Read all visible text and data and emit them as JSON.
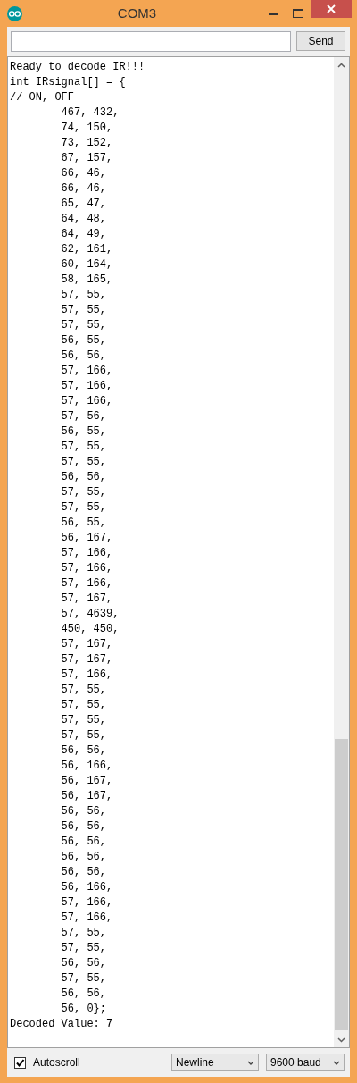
{
  "window": {
    "title": "COM3"
  },
  "send_button": "Send",
  "lines": [
    {
      "text": "Ready to decode IR!!!"
    },
    {
      "text": "int IRsignal[] = {"
    },
    {
      "text": "// ON, OFF"
    },
    {
      "text": "\t467, 432,"
    },
    {
      "text": "\t74, 150,"
    },
    {
      "text": "\t73, 152,"
    },
    {
      "text": "\t67, 157,"
    },
    {
      "text": "\t66, 46,"
    },
    {
      "text": "\t66, 46,"
    },
    {
      "text": "\t65, 47,"
    },
    {
      "text": "\t64, 48,"
    },
    {
      "text": "\t64, 49,"
    },
    {
      "text": "\t62, 161,"
    },
    {
      "text": "\t60, 164,"
    },
    {
      "text": "\t58, 165,"
    },
    {
      "text": "\t57, 55,"
    },
    {
      "text": "\t57, 55,"
    },
    {
      "text": "\t57, 55,"
    },
    {
      "text": "\t56, 55,"
    },
    {
      "text": "\t56, 56,"
    },
    {
      "text": "\t57, 166,"
    },
    {
      "text": "\t57, 166,"
    },
    {
      "text": "\t57, 166,"
    },
    {
      "text": "\t57, 56,"
    },
    {
      "text": "\t56, 55,"
    },
    {
      "text": "\t57, 55,"
    },
    {
      "text": "\t57, 55,"
    },
    {
      "text": "\t56, 56,"
    },
    {
      "text": "\t57, 55,"
    },
    {
      "text": "\t57, 55,"
    },
    {
      "text": "\t56, 55,"
    },
    {
      "text": "\t56, 167,"
    },
    {
      "text": "\t57, 166,"
    },
    {
      "text": "\t57, 166,"
    },
    {
      "text": "\t57, 166,"
    },
    {
      "text": "\t57, 167,"
    },
    {
      "text": "\t57, 4639,"
    },
    {
      "text": "\t450, 450,"
    },
    {
      "text": "\t57, 167,"
    },
    {
      "text": "\t57, 167,"
    },
    {
      "text": "\t57, 166,"
    },
    {
      "text": "\t57, 55,"
    },
    {
      "text": "\t57, 55,"
    },
    {
      "text": "\t57, 55,"
    },
    {
      "text": "\t57, 55,"
    },
    {
      "text": "\t56, 56,"
    },
    {
      "text": "\t56, 166,"
    },
    {
      "text": "\t56, 167,"
    },
    {
      "text": "\t56, 167,"
    },
    {
      "text": "\t56, 56,"
    },
    {
      "text": "\t56, 56,"
    },
    {
      "text": "\t56, 56,"
    },
    {
      "text": "\t56, 56,"
    },
    {
      "text": "\t56, 56,"
    },
    {
      "text": "\t56, 166,"
    },
    {
      "text": "\t57, 166,"
    },
    {
      "text": "\t57, 166,"
    },
    {
      "text": "\t57, 55,"
    },
    {
      "text": "\t57, 55,"
    },
    {
      "text": "\t56, 56,"
    },
    {
      "text": "\t57, 55,"
    },
    {
      "text": "\t56, 56,"
    },
    {
      "text": "\t56, 0};"
    },
    {
      "text": "Decoded Value: 7"
    }
  ],
  "autoscroll": {
    "label": "Autoscroll",
    "checked": true
  },
  "line_ending": "Newline",
  "baud": "9600 baud"
}
